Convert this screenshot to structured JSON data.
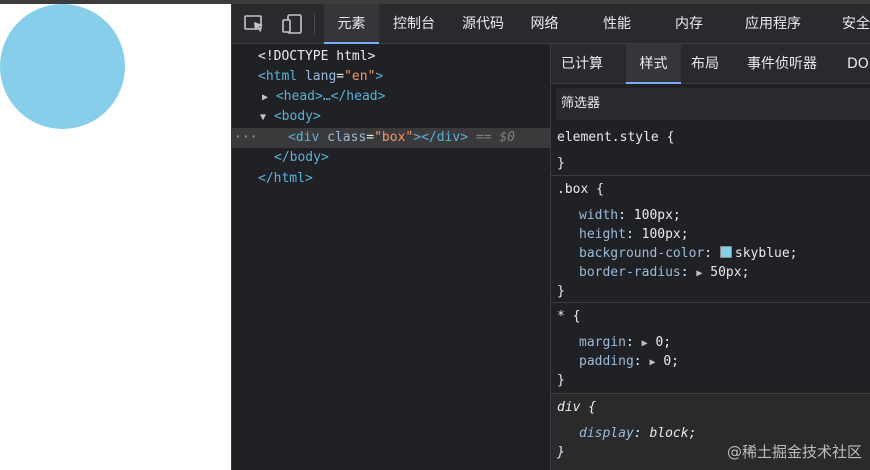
{
  "toolbar": {
    "tabs": [
      "元素",
      "控制台",
      "源代码",
      "网络",
      "性能",
      "内存",
      "应用程序",
      "安全"
    ]
  },
  "dom": {
    "doctype": "<!DOCTYPE html>",
    "html_open": "<html",
    "html_attr": "lang",
    "html_attr_value": "\"en\"",
    "html_close_bracket": ">",
    "head": "<head>…</head>",
    "body_open": "<body>",
    "div_open": "<div",
    "div_attr": "class",
    "div_attr_value": "\"box\"",
    "div_close": "></div>",
    "selected_marker": "== $0",
    "body_close": "</body>",
    "html_close": "</html>",
    "ellipsis": "···"
  },
  "styles": {
    "subtabs": [
      "已计算",
      "样式",
      "布局",
      "事件侦听器",
      "DO"
    ],
    "filter_placeholder": "筛选器",
    "rules": {
      "element_style": {
        "selector": "element.style {",
        "close": "}"
      },
      "box": {
        "selector": ".box {",
        "props": [
          {
            "name": "width",
            "value": "100px;"
          },
          {
            "name": "height",
            "value": "100px;"
          },
          {
            "name": "background-color",
            "value": "skyblue;",
            "swatch": "#87ceeb"
          },
          {
            "name": "border-radius",
            "value": "50px;"
          }
        ],
        "close": "}"
      },
      "universal": {
        "selector": "* {",
        "props": [
          {
            "name": "margin",
            "value": "0;"
          },
          {
            "name": "padding",
            "value": "0;"
          }
        ],
        "close": "}"
      },
      "div_ua": {
        "selector": "div {",
        "props": [
          {
            "name": "display",
            "value": "block;"
          }
        ],
        "close": "}"
      }
    }
  },
  "watermark": "@稀土掘金技术社区",
  "colors": {
    "box": "#87ceeb",
    "devtools_bg": "#202124",
    "accent": "#7cacf8"
  }
}
